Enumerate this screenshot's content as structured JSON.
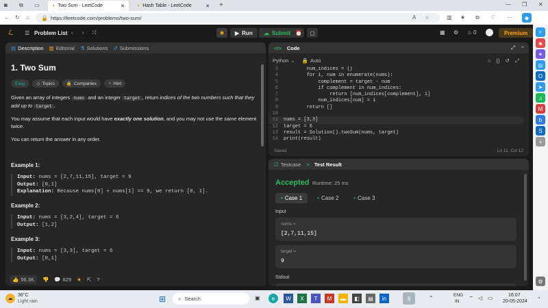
{
  "browser": {
    "tabs": [
      {
        "label": "Two Sum - LeetCode"
      },
      {
        "label": "Hash Table - LeetCode"
      }
    ],
    "url": "https://leetcode.com/problems/two-sum/"
  },
  "nav": {
    "problem_list": "Problem List",
    "run": "Run",
    "submit": "Submit",
    "streak": "0",
    "premium": "Premium"
  },
  "description": {
    "tabs": [
      "Description",
      "Editorial",
      "Solutions",
      "Submissions"
    ],
    "title": "1. Two Sum",
    "difficulty": "Easy",
    "chips": [
      "Topics",
      "Companies",
      "Hint"
    ],
    "p1_a": "Given an array of integers ",
    "p1_nums": "nums",
    "p1_b": " and an integer ",
    "p1_target": "target",
    "p1_c": ", return ",
    "p1_d": "indices of the two numbers such that they add up to",
    "p1_e": "target",
    "p1_f": ".",
    "p2_a": "You may assume that each input would have ",
    "p2_b": "exactly one solution",
    "p2_c": ", and you may not use the ",
    "p2_d": "same",
    "p2_e": " element twice.",
    "p3": "You can return the answer in any order.",
    "examples": [
      {
        "title": "Example 1:",
        "input": "nums = [2,7,11,15], target = 9",
        "output": "[0,1]",
        "explanation": "Because nums[0] + nums[1] == 9, we return [0, 1]."
      },
      {
        "title": "Example 2:",
        "input": "nums = [3,2,4], target = 6",
        "output": "[1,2]"
      },
      {
        "title": "Example 3:",
        "input": "nums = [3,3], target = 6",
        "output": "[0,1]"
      }
    ],
    "labels": {
      "input": "Input:",
      "output": "Output:",
      "explanation": "Explanation:"
    },
    "likes": "56.3K",
    "comments": "829"
  },
  "code": {
    "header": "Code",
    "language": "Python",
    "mode": "Auto",
    "lines": [
      {
        "n": "3",
        "t": "        num_indices = {}"
      },
      {
        "n": "4",
        "t": "        for i, num in enumerate(nums):"
      },
      {
        "n": "5",
        "t": "            complement = target - num"
      },
      {
        "n": "6",
        "t": "            if complement in num_indices:"
      },
      {
        "n": "7",
        "t": "                return [num_indices[complement], i]"
      },
      {
        "n": "8",
        "t": "            num_indices[num] = i"
      },
      {
        "n": "9",
        "t": "        return []"
      },
      {
        "n": "10",
        "t": ""
      },
      {
        "n": "11",
        "t": "nums = [3,3]"
      },
      {
        "n": "12",
        "t": "target = 6"
      },
      {
        "n": "13",
        "t": "result = Solution().twoSum(nums, target)"
      },
      {
        "n": "14",
        "t": "print(result)"
      }
    ],
    "saved": "Saved",
    "cursor": "Ln 11, Col 12"
  },
  "result": {
    "tabs": [
      "Testcase",
      "Test Result"
    ],
    "status": "Accepted",
    "runtime": "Runtime: 25 ms",
    "cases": [
      "Case 1",
      "Case 2",
      "Case 3"
    ],
    "input_label": "Input",
    "vars": [
      {
        "name": "nums =",
        "value": "[2,7,11,15]"
      },
      {
        "name": "target =",
        "value": "9"
      }
    ],
    "stdout_label": "Stdout"
  },
  "taskbar": {
    "temp": "36°C",
    "weather": "Light rain",
    "search": "Search",
    "lang1": "ENG",
    "lang2": "IN",
    "time": "16:07",
    "date": "20-05-2024"
  },
  "colors": {
    "accent_green": "#2cbb5d",
    "premium": "#ffa116",
    "easy": "#00b8a3"
  }
}
